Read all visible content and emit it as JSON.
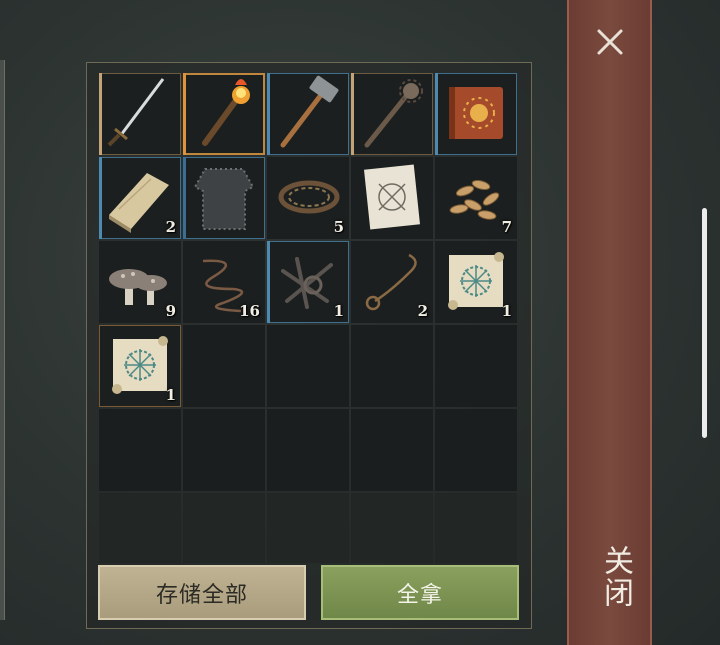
{
  "inventory": {
    "slots": [
      {
        "item": "sword-icon",
        "quality": "q-tan",
        "count": ""
      },
      {
        "item": "flaming-torch-icon",
        "quality": "q-orange",
        "count": ""
      },
      {
        "item": "hammer-icon",
        "quality": "q-blue",
        "count": ""
      },
      {
        "item": "spiked-mace-icon",
        "quality": "q-tan",
        "count": ""
      },
      {
        "item": "sun-book-icon",
        "quality": "q-blue",
        "count": ""
      },
      {
        "item": "wood-plank-icon",
        "quality": "q-blue",
        "count": "2"
      },
      {
        "item": "chainmail-armor-icon",
        "quality": "q-blue2",
        "count": ""
      },
      {
        "item": "bear-trap-icon",
        "quality": "",
        "count": "5"
      },
      {
        "item": "blueprint-paper-icon",
        "quality": "",
        "count": ""
      },
      {
        "item": "seeds-icon",
        "quality": "",
        "count": "7"
      },
      {
        "item": "mushroom-icon",
        "quality": "",
        "count": "9"
      },
      {
        "item": "wire-icon",
        "quality": "",
        "count": "16"
      },
      {
        "item": "scrap-metal-icon",
        "quality": "q-blue",
        "count": "1"
      },
      {
        "item": "rope-icon",
        "quality": "",
        "count": "2"
      },
      {
        "item": "recipe-scroll-icon",
        "quality": "",
        "count": "1"
      },
      {
        "item": "recipe-scroll-icon",
        "quality": "q-orange-plain",
        "count": "1"
      }
    ],
    "empty_slots": 14
  },
  "buttons": {
    "store_all": "存储全部",
    "take_all": "全拿"
  },
  "close": {
    "label": "关闭"
  },
  "colors": {
    "quality_tan": "#c2a477",
    "quality_orange": "#e09338",
    "quality_blue": "#4e8ab0",
    "store_button": "#b5a988",
    "take_button": "#7c9452",
    "close_bar": "#74443a"
  }
}
